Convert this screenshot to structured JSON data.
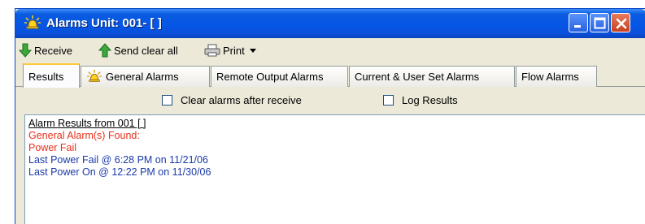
{
  "window": {
    "title": "Alarms Unit: 001- [ ]",
    "icon": "alarm-bell-icon"
  },
  "toolbar": {
    "receive_label": "Receive",
    "send_clear_label": "Send clear all",
    "print_label": "Print"
  },
  "tabs": [
    {
      "label": "Results",
      "active": true
    },
    {
      "label": "General Alarms",
      "icon": "alarm-bell-icon"
    },
    {
      "label": "Remote Output Alarms"
    },
    {
      "label": "Current & User Set Alarms"
    },
    {
      "label": "Flow Alarms"
    }
  ],
  "options": {
    "clear_after_receive": {
      "label": "Clear alarms after receive",
      "checked": false
    },
    "log_results": {
      "label": "Log Results",
      "checked": false
    }
  },
  "results": {
    "lines": [
      {
        "text": "Alarm Results from 001 [ ]",
        "color": "#000000"
      },
      {
        "text": "General Alarm(s) Found:",
        "color": "#e8301c"
      },
      {
        "text": "Power Fail",
        "color": "#e8301c"
      },
      {
        "text": "Last Power Fail @ 6:28 PM on 11/21/06",
        "color": "#1a3aa8"
      },
      {
        "text": "Last Power On @ 12:22 PM on 11/30/06",
        "color": "#1a3aa8"
      }
    ]
  }
}
